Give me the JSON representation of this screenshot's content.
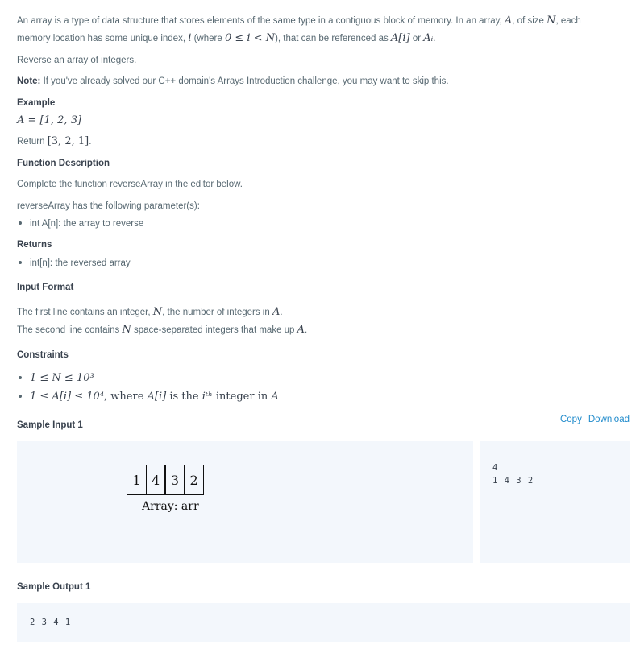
{
  "intro": {
    "t1": "An array is a type of data structure that stores elements of the same type in a contiguous block of memory. In an array, ",
    "m_A": "A",
    "t2": ", of size ",
    "m_N": "N",
    "t3": ", each",
    "t4": "memory location has some unique index, ",
    "m_i": "i",
    "t5": " (where ",
    "m_range": "0 ≤ i < N",
    "t6": "), that can be referenced as ",
    "m_Ai": "A[i]",
    "t7": " or ",
    "m_Asub": "Aᵢ",
    "t8": "."
  },
  "task": "Reverse an array of integers.",
  "note": {
    "label": "Note:",
    "text": " If you've already solved our C++ domain's Arrays Introduction challenge, you may want to skip this."
  },
  "example": {
    "heading": "Example",
    "math": "A = [1, 2, 3]",
    "return_text": "Return ",
    "return_math": "[3, 2, 1]",
    "return_end": "."
  },
  "function_description": {
    "heading": "Function Description",
    "line1": "Complete the function reverseArray in the editor below.",
    "line2": "reverseArray has the following parameter(s):",
    "params": [
      "int A[n]: the array to reverse"
    ]
  },
  "returns": {
    "heading": "Returns",
    "items": [
      "int[n]: the reversed array"
    ]
  },
  "input_format": {
    "heading": "Input Format",
    "l1a": "The first line contains an integer, ",
    "l1m": "N",
    "l1b": ", the number of integers in ",
    "l1m2": "A",
    "l1c": ".",
    "l2a": "The second line contains ",
    "l2m": "N",
    "l2b": " space-separated integers that make up ",
    "l2m2": "A",
    "l2c": "."
  },
  "constraints": {
    "heading": "Constraints",
    "c1": "1 ≤ N ≤ 10³",
    "c2a": "1 ≤ A[i] ≤ 10⁴",
    "c2b": ", where ",
    "c2c": "A[i]",
    "c2d": " is the ",
    "c2e": "iᵗʰ",
    "c2f": " integer in ",
    "c2g": "A"
  },
  "sample_input": {
    "heading": "Sample Input 1",
    "copy": "Copy",
    "download": "Download",
    "array_cells": [
      "1",
      "4",
      "3",
      "2"
    ],
    "array_label": "Array: arr",
    "lines": [
      "4",
      "1 4 3 2"
    ]
  },
  "sample_output": {
    "heading": "Sample Output 1",
    "lines": [
      "2 3 4 1"
    ]
  }
}
